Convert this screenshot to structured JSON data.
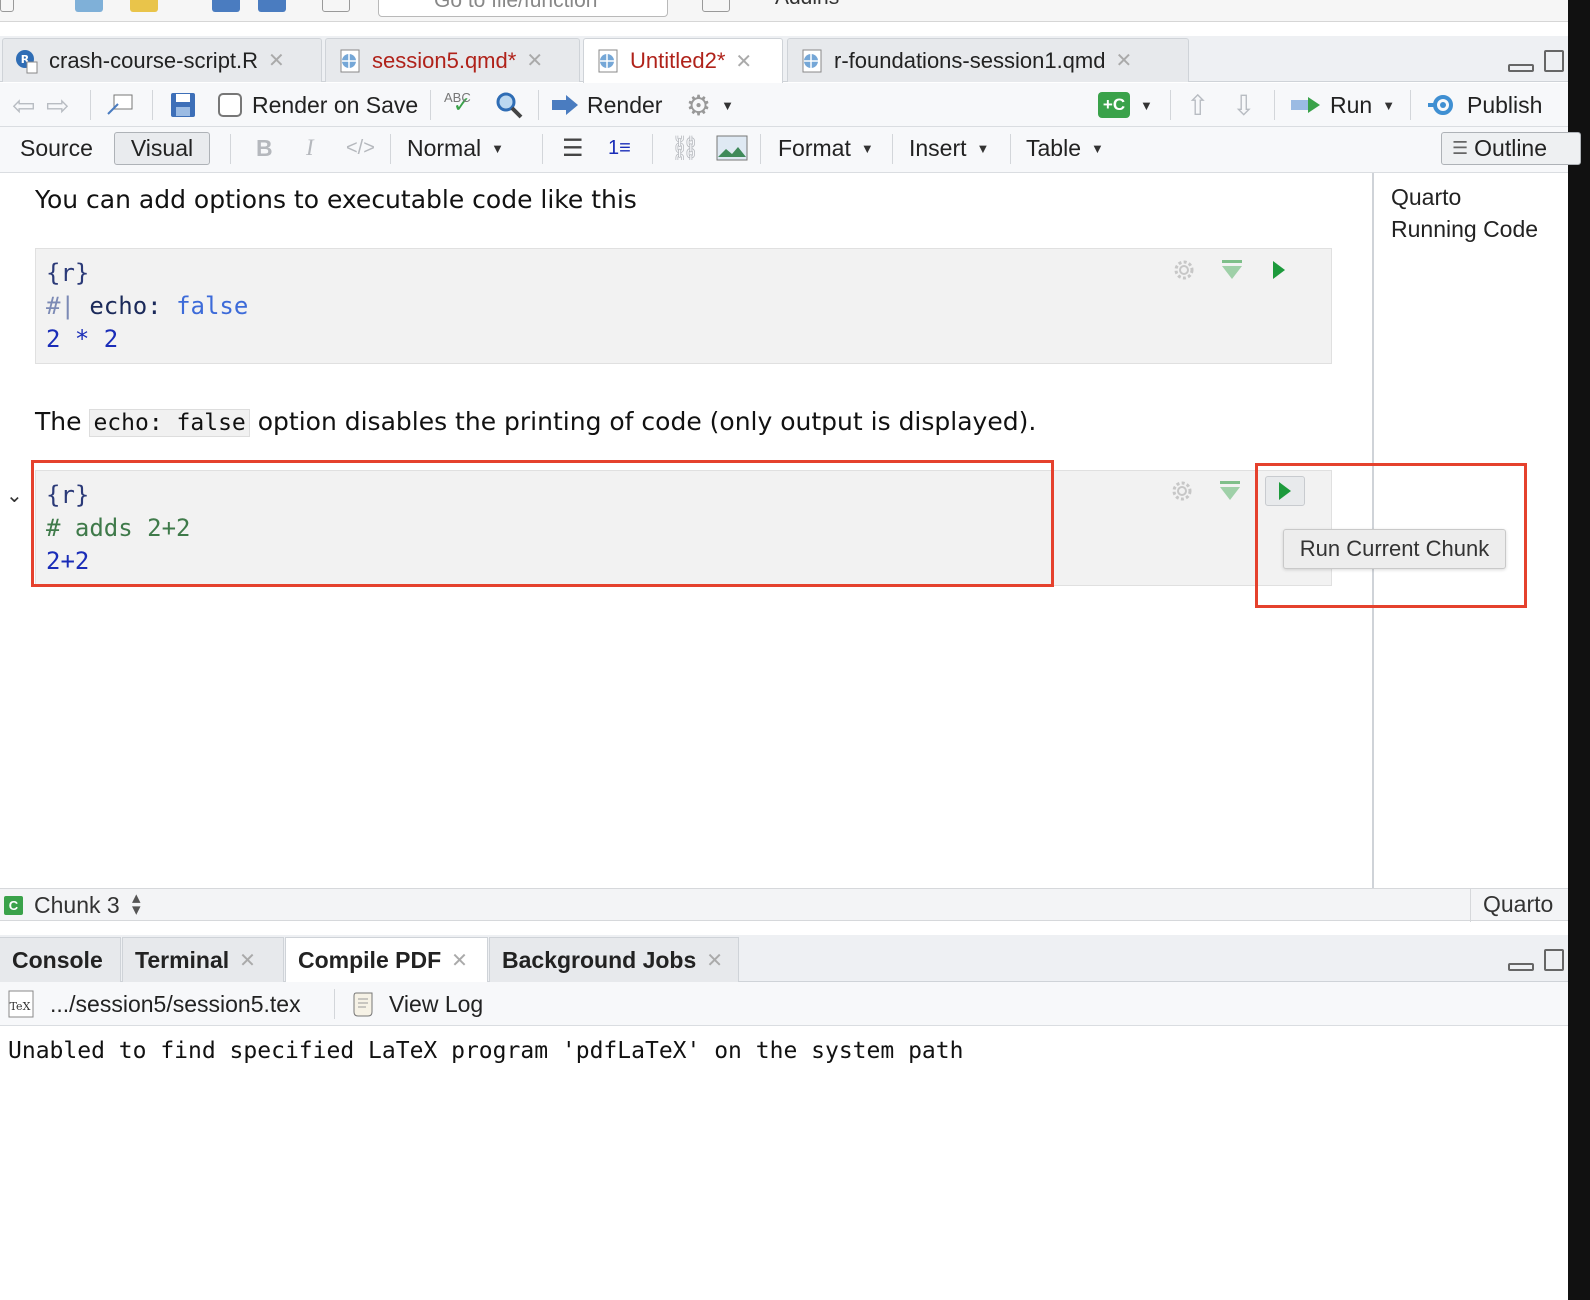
{
  "toolbar_top": {
    "goto_placeholder": "Go to file/function",
    "addins_label": "Addins"
  },
  "tabs": [
    {
      "label": "crash-course-script.R",
      "kind": "r",
      "modified": false
    },
    {
      "label": "session5.qmd*",
      "kind": "qmd",
      "modified": true
    },
    {
      "label": "Untitled2*",
      "kind": "qmd",
      "modified": true
    },
    {
      "label": "r-foundations-session1.qmd",
      "kind": "qmd",
      "modified": false
    }
  ],
  "editor_toolbar": {
    "render_on_save": "Render on Save",
    "spell_label": "ABC",
    "render": "Render",
    "run": "Run",
    "publish": "Publish"
  },
  "visual_toolbar": {
    "source": "Source",
    "visual": "Visual",
    "bold": "B",
    "italic": "I",
    "code": "</>",
    "style": "Normal",
    "format": "Format",
    "insert": "Insert",
    "table": "Table",
    "outline": "Outline"
  },
  "content": {
    "para1": "You can add options to executable code like this",
    "chunk1": {
      "header": "{r}",
      "line1_comment": "#|",
      "line1_key": "echo:",
      "line1_value": "false",
      "line2": "2 * 2"
    },
    "para2_before": "The",
    "para2_code": "echo: false",
    "para2_after": "option disables the printing of code (only output is displayed).",
    "chunk2": {
      "header": "{r}",
      "comment": "# adds 2+2",
      "code": "2+2"
    },
    "tooltip": "Run Current Chunk"
  },
  "outline": {
    "items": [
      "Quarto",
      "Running Code"
    ]
  },
  "status": {
    "chunk": "Chunk 3",
    "chunk_icon": "C",
    "doc_type": "Quarto"
  },
  "console_tabs": [
    {
      "label": "Console",
      "closable": false
    },
    {
      "label": "Terminal",
      "closable": true
    },
    {
      "label": "Compile PDF",
      "closable": true
    },
    {
      "label": "Background Jobs",
      "closable": true
    }
  ],
  "console_toolbar": {
    "file": ".../session5/session5.tex",
    "view_log": "View Log"
  },
  "console_output": "Unabled to find specified LaTeX program 'pdfLaTeX' on the system path",
  "colors": {
    "highlight": "#e5412d",
    "run_green": "#1d9a3c",
    "modified_tab": "#b0221a"
  }
}
